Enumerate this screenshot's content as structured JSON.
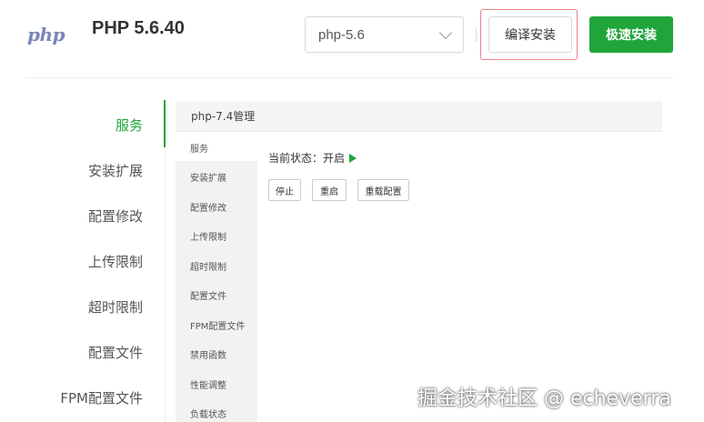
{
  "header": {
    "logo_text": "php",
    "title": "PHP 5.6.40",
    "version_select": {
      "selected": "php-5.6"
    },
    "compile_install_label": "编译安装",
    "fast_install_label": "极速安装"
  },
  "left_nav": {
    "items": [
      {
        "label": "服务",
        "active": true
      },
      {
        "label": "安装扩展"
      },
      {
        "label": "配置修改"
      },
      {
        "label": "上传限制"
      },
      {
        "label": "超时限制"
      },
      {
        "label": "配置文件"
      },
      {
        "label": "FPM配置文件"
      }
    ]
  },
  "panel": {
    "title": "php-7.4管理",
    "sub_nav": [
      {
        "label": "服务",
        "active": true
      },
      {
        "label": "安装扩展"
      },
      {
        "label": "配置修改"
      },
      {
        "label": "上传限制"
      },
      {
        "label": "超时限制"
      },
      {
        "label": "配置文件"
      },
      {
        "label": "FPM配置文件"
      },
      {
        "label": "禁用函数"
      },
      {
        "label": "性能调整"
      },
      {
        "label": "负载状态"
      }
    ],
    "status_label": "当前状态：",
    "status_value": "开启",
    "buttons": {
      "stop": "停止",
      "restart": "重启",
      "reload": "重载配置"
    }
  },
  "watermark": "掘金技术社区 @ echeverra",
  "colors": {
    "accent": "#20a53a",
    "highlight_border": "#e8808a"
  }
}
